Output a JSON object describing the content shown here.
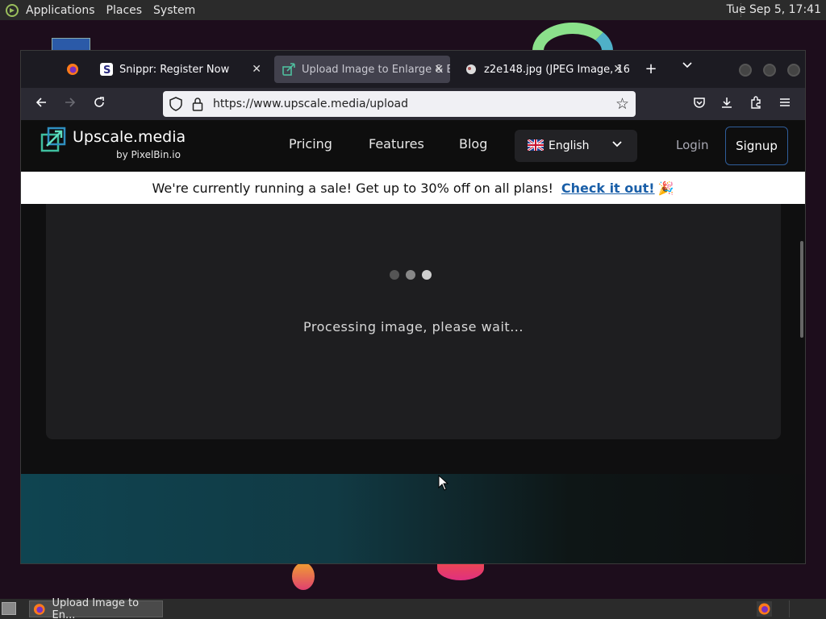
{
  "top_panel": {
    "menus": [
      "Applications",
      "Places",
      "System"
    ],
    "clock": "Tue Sep  5, 17:41"
  },
  "browser": {
    "tabs": [
      {
        "title": "",
        "favicon": "firefox-icon"
      },
      {
        "title": "Snippr: Register Now",
        "favicon": "snippr-s-icon"
      },
      {
        "title": "Upload Image to Enlarge & E",
        "favicon": "upscale-icon",
        "active": true
      },
      {
        "title": "z2e148.jpg (JPEG Image, 16(",
        "favicon": "image-icon"
      }
    ],
    "new_tab_label": "+",
    "list_tabs_label": "⌄",
    "url": "https://www.upscale.media/upload"
  },
  "site": {
    "logo_name": "Upscale.media",
    "logo_by": "by PixelBin.io",
    "nav": [
      "Pricing",
      "Features",
      "Blog"
    ],
    "language": "English",
    "login": "Login",
    "signup": "Signup",
    "sale_text": "We're currently running a sale! Get up to 30% off on all plans!",
    "sale_cta": "Check it out!",
    "processing_text": "Processing image, please wait..."
  },
  "taskbar": {
    "task_title": "Upload Image to En..."
  },
  "colors": {
    "accent": "#1a5fa8",
    "header_bg": "#0e0e0e",
    "card_bg": "#1e1e20"
  }
}
